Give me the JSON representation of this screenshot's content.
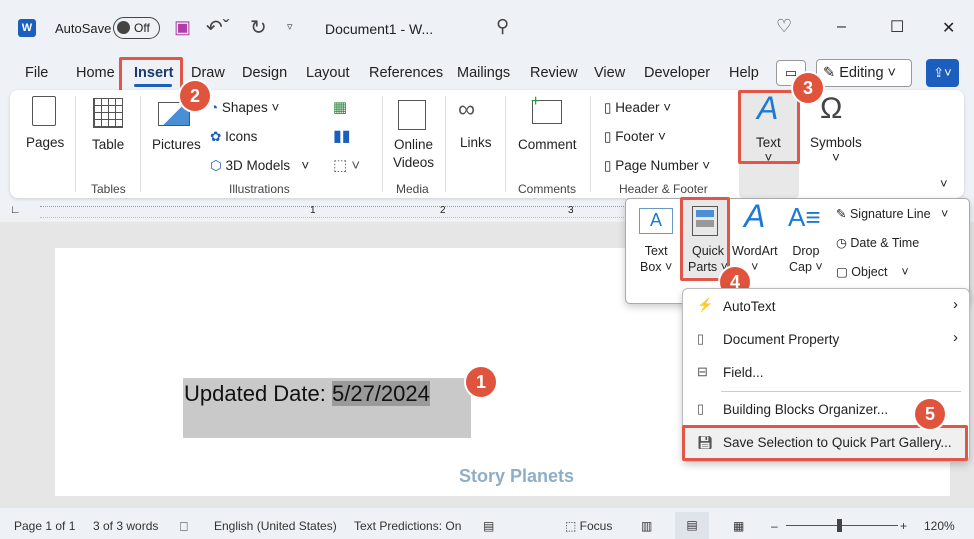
{
  "titlebar": {
    "autosave": "AutoSave",
    "toggle": "Off",
    "doc_title": "Document1  -  W...",
    "minimize": "–",
    "maximize": "☐",
    "close": "✕"
  },
  "menu_tabs": [
    "File",
    "Home",
    "Insert",
    "Draw",
    "Design",
    "Layout",
    "References",
    "Mailings",
    "Review",
    "View",
    "Developer",
    "Help"
  ],
  "editing": "Editing",
  "ribbon": {
    "pages": "Pages",
    "table": "Table",
    "tables_group": "Tables",
    "pictures": "Pictures",
    "shapes": "Shapes",
    "icons": "Icons",
    "models": "3D Models",
    "illustrations_group": "Illustrations",
    "online": "Online",
    "videos": "Videos",
    "media_group": "Media",
    "links": "Links",
    "comment": "Comment",
    "comments_group": "Comments",
    "header": "Header",
    "footer": "Footer",
    "page_number": "Page Number",
    "hf_group": "Header & Footer",
    "text": "Text",
    "symbols": "Symbols"
  },
  "text_panel": {
    "text_box_1": "Text",
    "text_box_2": "Box",
    "quick_1": "Quick",
    "quick_2": "Parts",
    "wordart": "WordArt",
    "drop_1": "Drop",
    "drop_2": "Cap",
    "signature": "Signature Line",
    "datetime": "Date & Time",
    "object": "Object"
  },
  "quick_menu": [
    "AutoText",
    "Document Property",
    "Field...",
    "Building Blocks Organizer...",
    "Save Selection to Quick Part Gallery..."
  ],
  "document": {
    "label": "Updated Date: ",
    "date": "5/27/2024",
    "watermark": "Story Planets"
  },
  "ruler": [
    "1",
    "2",
    "3"
  ],
  "badges": [
    "1",
    "2",
    "3",
    "4",
    "5"
  ],
  "status": {
    "page": "Page 1 of 1",
    "words": "3 of 3 words",
    "lang": "English (United States)",
    "pred": "Text Predictions: On",
    "focus": "Focus",
    "zoom": "120%"
  },
  "zoom_level_percent": 120
}
